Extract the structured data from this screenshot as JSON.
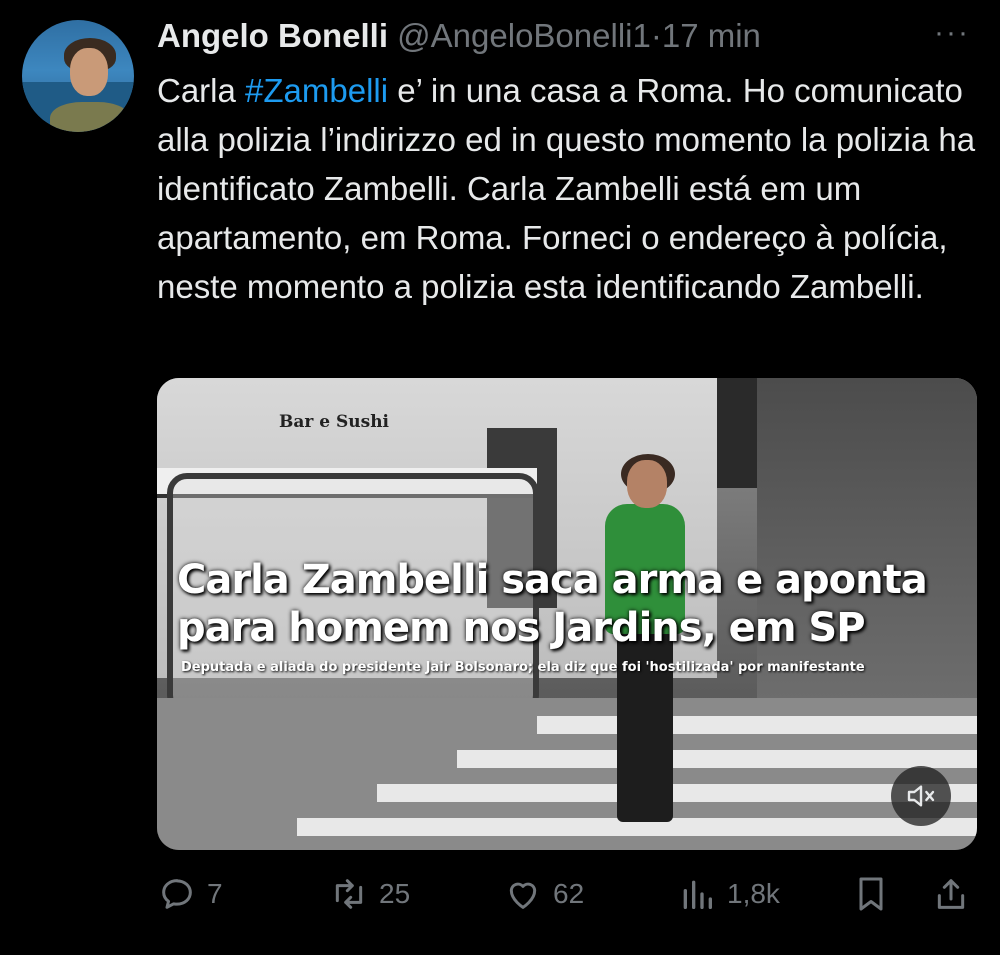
{
  "author": {
    "name": "Angelo Bonelli",
    "handle": "@AngeloBonelli1",
    "separator": "·",
    "time": "17 min"
  },
  "more_label": "···",
  "tweet": {
    "prefix": "Carla ",
    "hashtag": "#Zambelli",
    "body": " e’ in una casa a Roma.  Ho comunicato alla polizia l’indirizzo ed  in questo momento la polizia ha identificato Zambelli. Carla Zambelli está em um apartamento, em Roma. Forneci o endereço à polícia, neste momento a polizia  esta identificando Zambelli."
  },
  "media": {
    "store_sign": "Bar e Sushi",
    "caption": "Carla Zambelli saca arma e aponta para homem nos Jardins, em SP",
    "subcaption": "Deputada e aliada do presidente Jair Bolsonaro; ela diz que foi 'hostilizada' por manifestante",
    "mute_icon": "speaker-muted-icon"
  },
  "actions": {
    "replies": "7",
    "retweets": "25",
    "likes": "62",
    "views": "1,8k"
  },
  "colors": {
    "background": "#000000",
    "text": "#e7e9ea",
    "secondary": "#71767b",
    "accent": "#1d9bf0"
  }
}
